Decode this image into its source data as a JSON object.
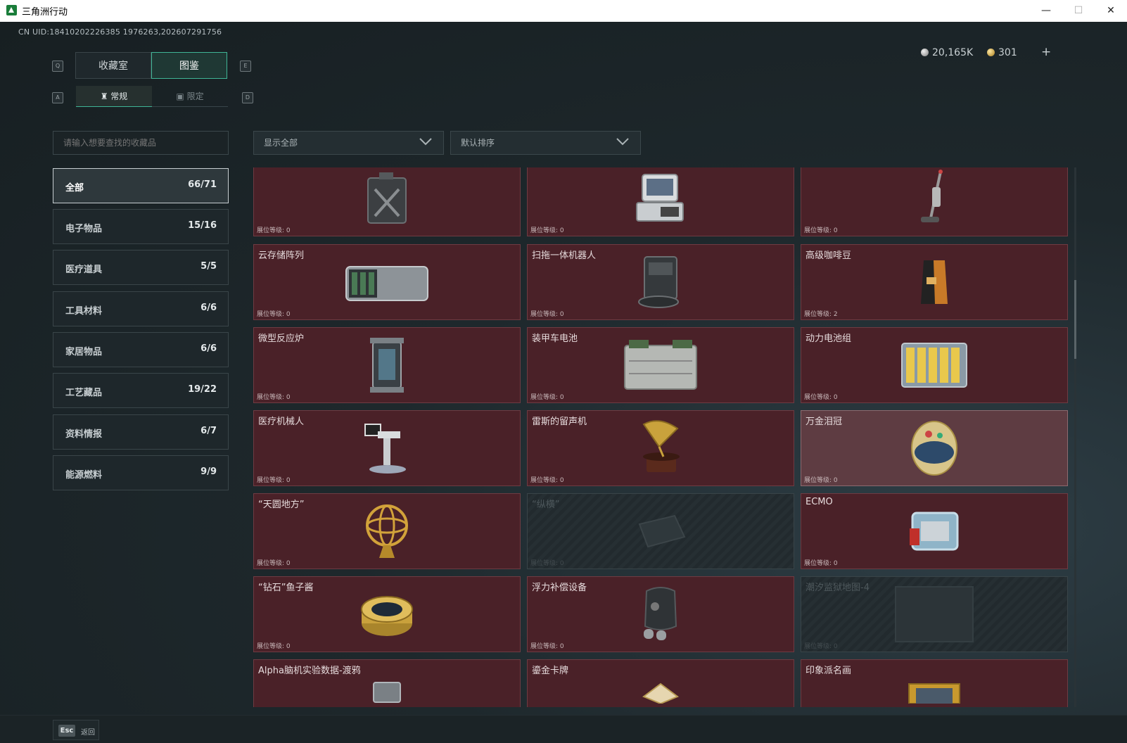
{
  "window": {
    "title": "三角洲行动",
    "minimize": "—",
    "maximize": "☐",
    "close": "✕"
  },
  "uid": "CN UID:18410202226385 1976263,202607291756",
  "currency": {
    "silver": "20,165K",
    "gold": "301",
    "plus": "+"
  },
  "keys": {
    "q": "Q",
    "e": "E",
    "a": "A",
    "d": "D"
  },
  "tabs": [
    {
      "label": "收藏室"
    },
    {
      "label": "图鉴"
    }
  ],
  "subtabs": [
    {
      "label": "常规"
    },
    {
      "label": "限定"
    }
  ],
  "search": {
    "placeholder": "请输入想要查找的收藏品"
  },
  "filters": {
    "display": "显示全部",
    "sort": "默认排序"
  },
  "categories": [
    {
      "name": "全部",
      "count": "66/71"
    },
    {
      "name": "电子物品",
      "count": "15/16"
    },
    {
      "name": "医疗道具",
      "count": "5/5"
    },
    {
      "name": "工具材料",
      "count": "6/6"
    },
    {
      "name": "家居物品",
      "count": "6/6"
    },
    {
      "name": "工艺藏品",
      "count": "19/22"
    },
    {
      "name": "资料情报",
      "count": "6/7"
    },
    {
      "name": "能源燃料",
      "count": "9/9"
    }
  ],
  "level_prefix": "展位等级:",
  "items": [
    {
      "name": "",
      "level": "0",
      "icon": "jerrycan-icon"
    },
    {
      "name": "",
      "level": "0",
      "icon": "computer-icon"
    },
    {
      "name": "",
      "level": "0",
      "icon": "vacuum-icon"
    },
    {
      "name": "云存储阵列",
      "level": "0",
      "icon": "storage-array-icon"
    },
    {
      "name": "扫拖一体机器人",
      "level": "0",
      "icon": "mop-robot-icon"
    },
    {
      "name": "高级咖啡豆",
      "level": "2",
      "icon": "coffee-bag-icon"
    },
    {
      "name": "微型反应炉",
      "level": "0",
      "icon": "reactor-icon"
    },
    {
      "name": "装甲车电池",
      "level": "0",
      "icon": "car-battery-icon"
    },
    {
      "name": "动力电池组",
      "level": "0",
      "icon": "battery-pack-icon"
    },
    {
      "name": "医疗机械人",
      "level": "0",
      "icon": "medical-robot-icon"
    },
    {
      "name": "雷斯的留声机",
      "level": "0",
      "icon": "gramophone-icon"
    },
    {
      "name": "万金泪冠",
      "level": "0",
      "icon": "jewel-egg-icon"
    },
    {
      "name": "“天圆地方”",
      "level": "0",
      "icon": "armillary-icon"
    },
    {
      "name": "“纵横”",
      "level": "0",
      "icon": "locked-board-icon"
    },
    {
      "name": "ECMO",
      "level": "0",
      "icon": "ecmo-icon"
    },
    {
      "name": "“钻石”鱼子酱",
      "level": "0",
      "icon": "caviar-tin-icon"
    },
    {
      "name": "浮力补偿设备",
      "level": "0",
      "icon": "bcd-vest-icon"
    },
    {
      "name": "潮汐监狱地图-4",
      "level": "0",
      "icon": "locked-map-icon"
    },
    {
      "name": "Alpha脑机实验数据-渡鸦",
      "level": "",
      "icon": "data-drive-icon"
    },
    {
      "name": "鎏金卡牌",
      "level": "",
      "icon": "gilded-card-icon"
    },
    {
      "name": "印象派名画",
      "level": "",
      "icon": "painting-icon"
    }
  ],
  "footer": {
    "esc_key": "Esc",
    "back_label": "返回"
  },
  "colors": {
    "accent": "#3fb596",
    "card_owned": "#4a2128",
    "card_locked": "#222a2e"
  }
}
